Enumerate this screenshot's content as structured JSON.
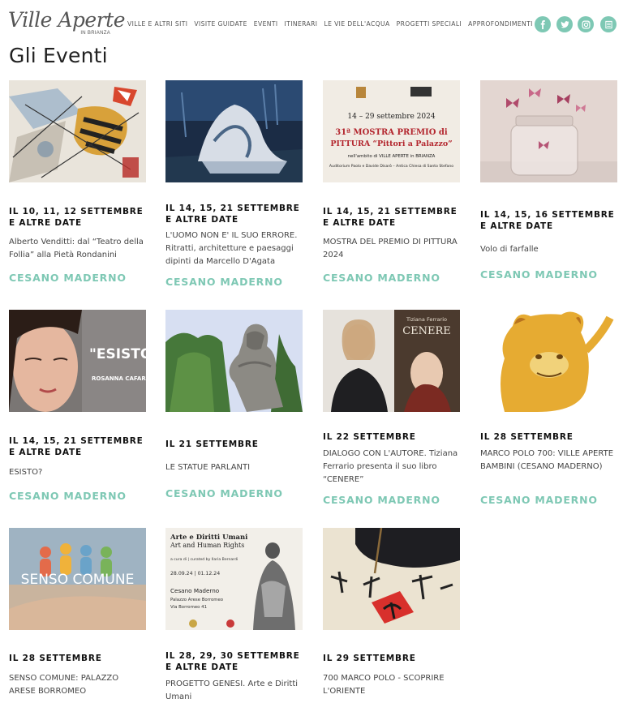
{
  "brand": {
    "name": "Ville Aperte",
    "sub": "IN BRIANZA"
  },
  "nav": [
    "VILLE E ALTRI SITI",
    "VISITE GUIDATE",
    "EVENTI",
    "ITINERARI",
    "LE VIE DELL'ACQUA",
    "PROGETTI SPECIALI",
    "APPROFONDIMENTI"
  ],
  "social": [
    "facebook-icon",
    "twitter-icon",
    "instagram-icon",
    "book-icon"
  ],
  "accent": "#7ec8b4",
  "page_title": "Gli Eventi",
  "events": [
    {
      "date": "IL 10, 11, 12 SETTEMBRE E ALTRE DATE",
      "title": "Alberto Venditti: dal “Teatro della Follia” alla Pietà Rondanini",
      "location": "CESANO MADERNO"
    },
    {
      "date": "IL 14, 15, 21 SETTEMBRE E ALTRE DATE",
      "title": "L'UOMO NON E' IL SUO ERRORE. Ritratti, architetture e paesaggi dipinti da Marcello D'Agata",
      "location": "CESANO MADERNO"
    },
    {
      "date": "IL 14, 15, 21 SETTEMBRE E ALTRE DATE",
      "title": "MOSTRA DEL PREMIO DI PITTURA 2024",
      "location": "CESANO MADERNO"
    },
    {
      "date": "IL 14, 15, 16 SETTEMBRE E ALTRE DATE",
      "title": "Volo di farfalle",
      "location": "CESANO MADERNO"
    },
    {
      "date": "IL 14, 15, 21 SETTEMBRE E ALTRE DATE",
      "title": "ESISTO?",
      "location": "CESANO MADERNO"
    },
    {
      "date": "IL 21 SETTEMBRE",
      "title": "LE STATUE PARLANTI",
      "location": "CESANO MADERNO"
    },
    {
      "date": "IL 22 SETTEMBRE",
      "title": "DIALOGO CON L'AUTORE. Tiziana Ferrario presenta il suo libro “CENERE”",
      "location": "CESANO MADERNO"
    },
    {
      "date": "IL 28 SETTEMBRE",
      "title": "MARCO POLO 700: VILLE APERTE BAMBINI (CESANO MADERNO)",
      "location": "CESANO MADERNO"
    },
    {
      "date": "IL 28 SETTEMBRE",
      "title": "SENSO COMUNE: PALAZZO ARESE BORROMEO",
      "location": ""
    },
    {
      "date": "IL 28, 29, 30 SETTEMBRE E ALTRE DATE",
      "title": "PROGETTO GENESI. Arte e Diritti Umani",
      "location": ""
    },
    {
      "date": "IL 29 SETTEMBRE",
      "title": "700 MARCO POLO - SCOPRIRE L'ORIENTE",
      "location": ""
    }
  ],
  "image_text": {
    "mostra_dates": "14 – 29 settembre 2024",
    "mostra_title_1": "31ª MOSTRA PREMIO di",
    "mostra_title_2": "PITTURA “Pittori a Palazzo”",
    "mostra_sub": "nell'ambito di VILLE APERTE in BRIANZA",
    "mostra_venue": "Auditorium Paolo e Davide Disarò – Antica Chiesa di Santo Stefano",
    "esisto": "\"ESISTO",
    "esisto_author": "ROSANNA CAFARO",
    "cenere_author": "Tiziana Ferrario",
    "cenere_title": "CENERE",
    "senso": "SENSO COMUNE",
    "genesi_title_1": "Arte e Diritti Umani",
    "genesi_title_2": "Art and Human Rights",
    "genesi_curated": "a cura di | curated by Ilaria Bernardi",
    "genesi_dates": "28.09.24 | 01.12.24",
    "genesi_place_1": "Cesano Maderno",
    "genesi_place_2": "Palazzo Arese Borromeo",
    "genesi_place_3": "Via Borromeo 41"
  }
}
